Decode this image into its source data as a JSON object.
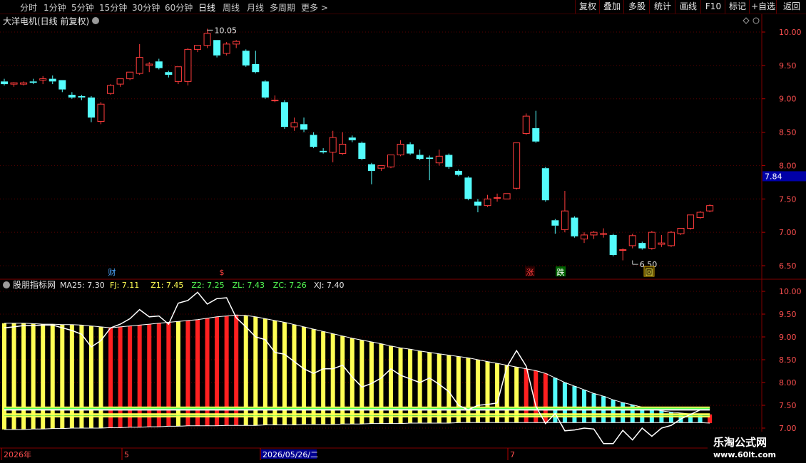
{
  "toolbar": {
    "timeframes": [
      "分时",
      "1分钟",
      "5分钟",
      "15分钟",
      "30分钟",
      "60分钟",
      "日线",
      "周线",
      "月线",
      "多周期",
      "更多 >"
    ],
    "active": "日线",
    "right": [
      "复权",
      "叠加",
      "多股",
      "统计",
      "画线",
      "F10",
      "标记",
      "+自选",
      "返回"
    ]
  },
  "main": {
    "title": "大洋电机(日线 前复权)",
    "y_ticks": [
      "10.00",
      "9.50",
      "9.00",
      "8.50",
      "8.00",
      "7.50",
      "7.00",
      "6.50"
    ],
    "current_price": "7.84",
    "max_label": "10.05",
    "min_label": "6.50",
    "markers": [
      "财",
      "$",
      "涨",
      "跌",
      "回"
    ],
    "colors": {
      "up": "#ff3c3c",
      "down": "#54fcfc",
      "grid": "#5a0000",
      "axis": "#800000"
    }
  },
  "indicator": {
    "name": "股朋指标网",
    "values": [
      {
        "k": "MA25",
        "v": "7.30",
        "color": "#e6e6e6"
      },
      {
        "k": "FJ",
        "v": "7.11",
        "color": "#ffff54"
      },
      {
        "k": "Z1",
        "v": "7.45",
        "color": "#ffff54"
      },
      {
        "k": "Z2",
        "v": "7.25",
        "color": "#54fc54"
      },
      {
        "k": "ZL",
        "v": "7.43",
        "color": "#54fc54"
      },
      {
        "k": "ZC",
        "v": "7.26",
        "color": "#54fc54"
      },
      {
        "k": "XJ",
        "v": "7.40",
        "color": "#e6e6e6"
      }
    ],
    "y_ticks": [
      "10.00",
      "9.50",
      "9.00",
      "8.50",
      "8.00",
      "7.50",
      "7.00"
    ]
  },
  "dates": {
    "items": [
      "2026年",
      "5",
      "2026/05/26/二",
      "7"
    ]
  },
  "watermark": {
    "line1": "乐淘公式网",
    "line2": "www.60lt.com"
  },
  "chart_data": {
    "type": "candlestick",
    "title": "大洋电机(日线 前复权)",
    "ylim": [
      6.35,
      10.05
    ],
    "candles": [
      [
        9.26,
        9.3,
        9.22,
        9.2
      ],
      [
        9.22,
        9.25,
        9.24,
        9.18
      ],
      [
        9.22,
        9.26,
        9.24,
        9.2
      ],
      [
        9.26,
        9.3,
        9.24,
        9.22
      ],
      [
        9.28,
        9.34,
        9.3,
        9.22
      ],
      [
        9.3,
        9.35,
        9.26,
        9.22
      ],
      [
        9.28,
        9.28,
        9.14,
        9.1
      ],
      [
        9.06,
        9.1,
        9.02,
        9.0
      ],
      [
        9.04,
        9.06,
        9.02,
        8.98
      ],
      [
        9.02,
        9.04,
        8.72,
        8.65
      ],
      [
        8.66,
        8.95,
        8.92,
        8.62
      ],
      [
        9.08,
        9.22,
        9.2,
        9.06
      ],
      [
        9.22,
        9.28,
        9.3,
        9.18
      ],
      [
        9.3,
        9.4,
        9.4,
        9.28
      ],
      [
        9.38,
        9.82,
        9.62,
        9.36
      ],
      [
        9.5,
        9.55,
        9.52,
        9.4
      ],
      [
        9.56,
        9.6,
        9.46,
        9.44
      ],
      [
        9.4,
        9.42,
        9.36,
        9.32
      ],
      [
        9.26,
        9.48,
        9.48,
        9.22
      ],
      [
        9.26,
        9.76,
        9.74,
        9.2
      ],
      [
        9.74,
        9.8,
        9.8,
        9.7
      ],
      [
        9.8,
        10.05,
        9.98,
        9.76
      ],
      [
        9.88,
        9.88,
        9.65,
        9.62
      ],
      [
        9.68,
        9.85,
        9.82,
        9.65
      ],
      [
        9.82,
        9.88,
        9.86,
        9.76
      ],
      [
        9.72,
        9.74,
        9.5,
        9.48
      ],
      [
        9.52,
        9.72,
        9.4,
        9.38
      ],
      [
        9.26,
        9.28,
        9.02,
        9.0
      ],
      [
        8.98,
        9.05,
        8.98,
        8.95
      ],
      [
        8.95,
        8.98,
        8.58,
        8.55
      ],
      [
        8.58,
        8.72,
        8.64,
        8.52
      ],
      [
        8.62,
        8.72,
        8.54,
        8.5
      ],
      [
        8.46,
        8.5,
        8.28,
        8.26
      ],
      [
        8.22,
        8.26,
        8.2,
        8.18
      ],
      [
        8.2,
        8.52,
        8.42,
        8.05
      ],
      [
        8.18,
        8.5,
        8.32,
        8.16
      ],
      [
        8.42,
        8.45,
        8.38,
        8.35
      ],
      [
        8.34,
        8.36,
        8.1,
        8.08
      ],
      [
        8.02,
        8.04,
        7.92,
        7.72
      ],
      [
        7.96,
        7.98,
        8.0,
        7.92
      ],
      [
        7.98,
        8.14,
        8.16,
        7.96
      ],
      [
        8.16,
        8.38,
        8.32,
        8.14
      ],
      [
        8.32,
        8.35,
        8.18,
        8.16
      ],
      [
        8.16,
        8.24,
        8.1,
        8.08
      ],
      [
        8.12,
        8.15,
        8.1,
        7.78
      ],
      [
        8.04,
        8.24,
        8.14,
        8.0
      ],
      [
        8.16,
        8.18,
        7.98,
        7.95
      ],
      [
        7.92,
        7.94,
        7.86,
        7.84
      ],
      [
        7.82,
        7.84,
        7.5,
        7.48
      ],
      [
        7.46,
        7.5,
        7.4,
        7.3
      ],
      [
        7.4,
        7.56,
        7.5,
        7.38
      ],
      [
        7.52,
        7.58,
        7.52,
        7.46
      ],
      [
        7.5,
        7.56,
        7.58,
        7.5
      ],
      [
        7.66,
        8.34,
        8.34,
        7.64
      ],
      [
        8.48,
        8.78,
        8.74,
        8.46
      ],
      [
        8.56,
        8.82,
        8.36,
        8.34
      ],
      [
        7.96,
        7.98,
        7.48,
        7.46
      ],
      [
        7.18,
        7.2,
        7.1,
        6.98
      ],
      [
        7.04,
        7.62,
        7.32,
        7.0
      ],
      [
        7.22,
        7.24,
        6.94,
        6.92
      ],
      [
        6.9,
        7.0,
        6.96,
        6.84
      ],
      [
        6.96,
        7.02,
        7.0,
        6.9
      ],
      [
        6.98,
        7.06,
        6.98,
        6.92
      ],
      [
        6.96,
        6.98,
        6.66,
        6.64
      ],
      [
        6.74,
        6.76,
        6.74,
        6.58
      ],
      [
        6.8,
        6.98,
        6.95,
        6.76
      ],
      [
        6.84,
        6.86,
        6.76,
        6.74
      ],
      [
        6.76,
        7.02,
        7.0,
        6.74
      ],
      [
        6.82,
        6.96,
        6.84,
        6.78
      ],
      [
        6.8,
        7.02,
        7.0,
        6.78
      ],
      [
        6.98,
        7.06,
        7.06,
        6.96
      ],
      [
        7.06,
        7.26,
        7.26,
        7.04
      ],
      [
        7.22,
        7.32,
        7.3,
        7.2
      ],
      [
        7.32,
        7.42,
        7.4,
        7.3
      ]
    ],
    "indicator": {
      "ylim": [
        6.95,
        10.05
      ],
      "bar_top": [
        9.3,
        9.3,
        9.3,
        9.29,
        9.28,
        9.28,
        9.27,
        9.27,
        9.26,
        9.24,
        9.22,
        9.2,
        9.22,
        9.24,
        9.26,
        9.28,
        9.3,
        9.32,
        9.34,
        9.36,
        9.38,
        9.41,
        9.44,
        9.46,
        9.48,
        9.47,
        9.44,
        9.4,
        9.36,
        9.32,
        9.27,
        9.22,
        9.17,
        9.12,
        9.07,
        9.02,
        8.97,
        8.93,
        8.89,
        8.85,
        8.8,
        8.76,
        8.73,
        8.69,
        8.66,
        8.63,
        8.6,
        8.57,
        8.54,
        8.5,
        8.46,
        8.42,
        8.38,
        8.34,
        8.3,
        8.26,
        8.2,
        8.1,
        8.0,
        7.92,
        7.84,
        7.76,
        7.7,
        7.62,
        7.56,
        7.51,
        7.46,
        7.42,
        7.38,
        7.35,
        7.33,
        7.31,
        7.3,
        7.3
      ],
      "bar_bottom": [
        6.97,
        6.97,
        6.97,
        6.98,
        6.98,
        6.99,
        6.99,
        7.0,
        7.0,
        7.0,
        7.0,
        7.01,
        7.01,
        7.02,
        7.02,
        7.03,
        7.03,
        7.04,
        7.04,
        7.05,
        7.05,
        7.05,
        7.05,
        7.06,
        7.06,
        7.06,
        7.06,
        7.07,
        7.07,
        7.07,
        7.07,
        7.08,
        7.08,
        7.08,
        7.08,
        7.09,
        7.09,
        7.09,
        7.1,
        7.1,
        7.1,
        7.1,
        7.11,
        7.11,
        7.11,
        7.11,
        7.11,
        7.12,
        7.12,
        7.12,
        7.12,
        7.12,
        7.12,
        7.12,
        7.12,
        7.12,
        7.12,
        7.12,
        7.12,
        7.12,
        7.12,
        7.12,
        7.12,
        7.12,
        7.12,
        7.12,
        7.12,
        7.12,
        7.12,
        7.12,
        7.12,
        7.12,
        7.12,
        7.11
      ],
      "bar_color": [
        "y",
        "y",
        "y",
        "y",
        "y",
        "y",
        "y",
        "y",
        "y",
        "y",
        "y",
        "r",
        "r",
        "r",
        "r",
        "r",
        "r",
        "r",
        "y",
        "r",
        "r",
        "r",
        "r",
        "r",
        "r",
        "y",
        "y",
        "y",
        "y",
        "y",
        "y",
        "y",
        "y",
        "y",
        "y",
        "y",
        "y",
        "y",
        "y",
        "y",
        "y",
        "y",
        "y",
        "y",
        "y",
        "y",
        "y",
        "y",
        "y",
        "y",
        "y",
        "y",
        "y",
        "y",
        "r",
        "r",
        "r",
        "c",
        "c",
        "c",
        "c",
        "c",
        "c",
        "c",
        "c",
        "c",
        "c",
        "c",
        "c",
        "c",
        "c",
        "c",
        "c",
        "r"
      ],
      "line": [
        9.2,
        9.22,
        9.25,
        9.25,
        9.26,
        9.26,
        9.2,
        9.14,
        9.06,
        8.78,
        8.92,
        9.2,
        9.28,
        9.4,
        9.6,
        9.44,
        9.46,
        9.28,
        9.74,
        9.8,
        9.98,
        9.72,
        9.84,
        9.86,
        9.42,
        9.22,
        9.0,
        8.94,
        8.66,
        8.62,
        8.46,
        8.3,
        8.2,
        8.3,
        8.3,
        8.38,
        8.12,
        7.9,
        7.98,
        8.1,
        8.3,
        8.16,
        8.08,
        8.0,
        8.1,
        7.96,
        7.8,
        7.5,
        7.4,
        7.5,
        7.52,
        7.55,
        8.34,
        8.7,
        8.36,
        7.48,
        7.1,
        7.32,
        6.94,
        6.96,
        7.0,
        6.98,
        6.66,
        6.66,
        6.95,
        6.74,
        7.0,
        6.82,
        7.0,
        7.06,
        7.2,
        7.3,
        7.4
      ],
      "h_lines": [
        {
          "name": "Z1",
          "v": 7.45,
          "color": "#ffff54"
        },
        {
          "name": "ZL",
          "v": 7.43,
          "color": "#54fc54"
        },
        {
          "name": "XJ",
          "v": 7.4,
          "color": "#ffffff"
        },
        {
          "name": "MA25",
          "v": 7.3,
          "color": "#ffff54"
        },
        {
          "name": "ZC",
          "v": 7.26,
          "color": "#54fc54"
        },
        {
          "name": "Z2",
          "v": 7.25,
          "color": "#ffff54"
        }
      ]
    }
  }
}
